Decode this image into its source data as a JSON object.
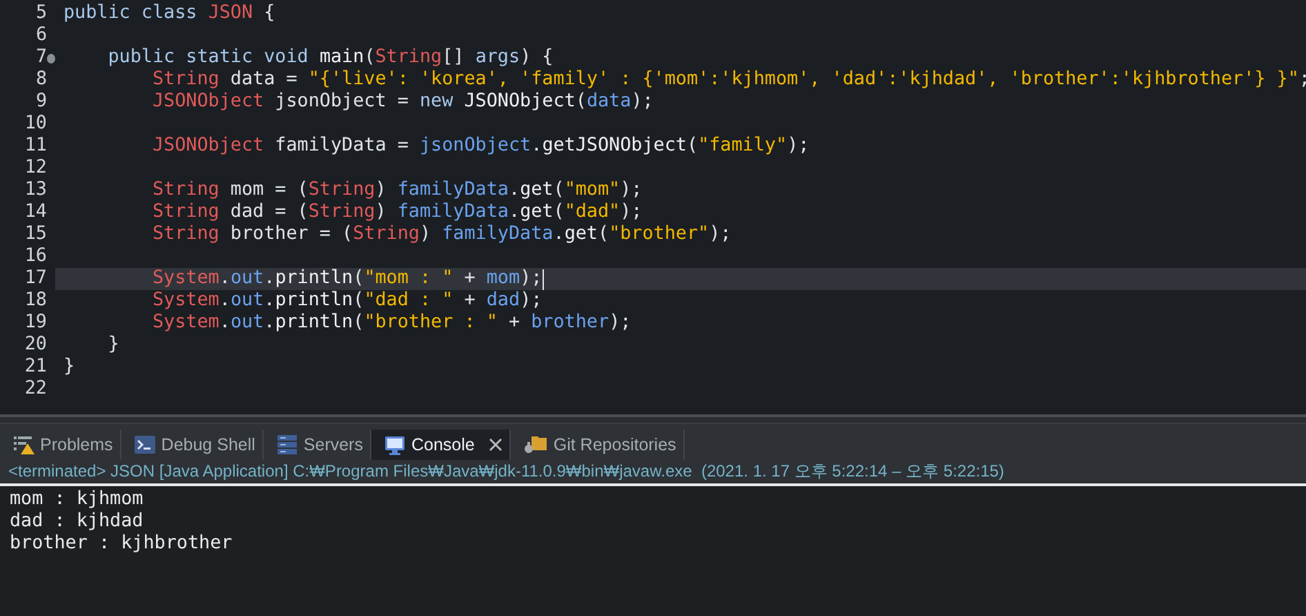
{
  "editor": {
    "lines": [
      {
        "number": "5",
        "tokens": [
          {
            "kind": "kw",
            "text": "public class "
          },
          {
            "kind": "type",
            "text": "JSON"
          },
          {
            "kind": "plain",
            "text": " {"
          }
        ]
      },
      {
        "number": "6"
      },
      {
        "number": "7",
        "fold": true,
        "tokens": [
          {
            "kind": "kw",
            "text": "    public static void "
          },
          {
            "kind": "method",
            "text": "main"
          },
          {
            "kind": "plain",
            "text": "("
          },
          {
            "kind": "type",
            "text": "String"
          },
          {
            "kind": "plain",
            "text": "[] "
          },
          {
            "kind": "kw",
            "text": "args"
          },
          {
            "kind": "plain",
            "text": ") {"
          }
        ]
      },
      {
        "number": "8",
        "tokens": [
          {
            "kind": "type",
            "text": "        String"
          },
          {
            "kind": "plain",
            "text": " data = "
          },
          {
            "kind": "str",
            "text": "\"{'live': 'korea', 'family' : {'mom':'kjhmom', 'dad':'kjhdad', 'brother':'kjhbrother'} }\""
          },
          {
            "kind": "plain",
            "text": ";"
          }
        ]
      },
      {
        "number": "9",
        "tokens": [
          {
            "kind": "type",
            "text": "        JSONObject"
          },
          {
            "kind": "plain",
            "text": " jsonObject = "
          },
          {
            "kind": "kw",
            "text": "new"
          },
          {
            "kind": "method",
            "text": " JSONObject"
          },
          {
            "kind": "plain",
            "text": "("
          },
          {
            "kind": "field",
            "text": "data"
          },
          {
            "kind": "plain",
            "text": ");"
          }
        ]
      },
      {
        "number": "10"
      },
      {
        "number": "11",
        "tokens": [
          {
            "kind": "type",
            "text": "        JSONObject"
          },
          {
            "kind": "plain",
            "text": " familyData = "
          },
          {
            "kind": "field",
            "text": "jsonObject"
          },
          {
            "kind": "plain",
            "text": "."
          },
          {
            "kind": "method",
            "text": "getJSONObject"
          },
          {
            "kind": "plain",
            "text": "("
          },
          {
            "kind": "str",
            "text": "\"family\""
          },
          {
            "kind": "plain",
            "text": ");"
          }
        ]
      },
      {
        "number": "12"
      },
      {
        "number": "13",
        "tokens": [
          {
            "kind": "type",
            "text": "        String"
          },
          {
            "kind": "plain",
            "text": " mom = ("
          },
          {
            "kind": "type",
            "text": "String"
          },
          {
            "kind": "plain",
            "text": ") "
          },
          {
            "kind": "field",
            "text": "familyData"
          },
          {
            "kind": "plain",
            "text": "."
          },
          {
            "kind": "method",
            "text": "get"
          },
          {
            "kind": "plain",
            "text": "("
          },
          {
            "kind": "str",
            "text": "\"mom\""
          },
          {
            "kind": "plain",
            "text": ");"
          }
        ]
      },
      {
        "number": "14",
        "tokens": [
          {
            "kind": "type",
            "text": "        String"
          },
          {
            "kind": "plain",
            "text": " dad = ("
          },
          {
            "kind": "type",
            "text": "String"
          },
          {
            "kind": "plain",
            "text": ") "
          },
          {
            "kind": "field",
            "text": "familyData"
          },
          {
            "kind": "plain",
            "text": "."
          },
          {
            "kind": "method",
            "text": "get"
          },
          {
            "kind": "plain",
            "text": "("
          },
          {
            "kind": "str",
            "text": "\"dad\""
          },
          {
            "kind": "plain",
            "text": ");"
          }
        ]
      },
      {
        "number": "15",
        "tokens": [
          {
            "kind": "type",
            "text": "        String"
          },
          {
            "kind": "plain",
            "text": " brother = ("
          },
          {
            "kind": "type",
            "text": "String"
          },
          {
            "kind": "plain",
            "text": ") "
          },
          {
            "kind": "field",
            "text": "familyData"
          },
          {
            "kind": "plain",
            "text": "."
          },
          {
            "kind": "method",
            "text": "get"
          },
          {
            "kind": "plain",
            "text": "("
          },
          {
            "kind": "str",
            "text": "\"brother\""
          },
          {
            "kind": "plain",
            "text": ");"
          }
        ]
      },
      {
        "number": "16"
      },
      {
        "number": "17",
        "current": true,
        "tokens": [
          {
            "kind": "type",
            "text": "        System"
          },
          {
            "kind": "plain",
            "text": "."
          },
          {
            "kind": "field",
            "text": "out"
          },
          {
            "kind": "plain",
            "text": "."
          },
          {
            "kind": "method",
            "text": "println"
          },
          {
            "kind": "plain",
            "text": "("
          },
          {
            "kind": "str",
            "text": "\"mom : \""
          },
          {
            "kind": "plain",
            "text": " + "
          },
          {
            "kind": "field",
            "text": "mom"
          },
          {
            "kind": "plain",
            "text": ");"
          }
        ]
      },
      {
        "number": "18",
        "tokens": [
          {
            "kind": "type",
            "text": "        System"
          },
          {
            "kind": "plain",
            "text": "."
          },
          {
            "kind": "field",
            "text": "out"
          },
          {
            "kind": "plain",
            "text": "."
          },
          {
            "kind": "method",
            "text": "println"
          },
          {
            "kind": "plain",
            "text": "("
          },
          {
            "kind": "str",
            "text": "\"dad : \""
          },
          {
            "kind": "plain",
            "text": " + "
          },
          {
            "kind": "field",
            "text": "dad"
          },
          {
            "kind": "plain",
            "text": ");"
          }
        ]
      },
      {
        "number": "19",
        "tokens": [
          {
            "kind": "type",
            "text": "        System"
          },
          {
            "kind": "plain",
            "text": "."
          },
          {
            "kind": "field",
            "text": "out"
          },
          {
            "kind": "plain",
            "text": "."
          },
          {
            "kind": "method",
            "text": "println"
          },
          {
            "kind": "plain",
            "text": "("
          },
          {
            "kind": "str",
            "text": "\"brother : \""
          },
          {
            "kind": "plain",
            "text": " + "
          },
          {
            "kind": "field",
            "text": "brother"
          },
          {
            "kind": "plain",
            "text": ");"
          }
        ]
      },
      {
        "number": "20",
        "tokens": [
          {
            "kind": "plain",
            "text": "    }"
          }
        ]
      },
      {
        "number": "21",
        "tokens": [
          {
            "kind": "plain",
            "text": "}"
          }
        ]
      },
      {
        "number": "22"
      }
    ]
  },
  "panel": {
    "tabs": [
      {
        "label": "Problems",
        "kind": "problems",
        "selected": false
      },
      {
        "label": "Debug Shell",
        "kind": "shell",
        "selected": false
      },
      {
        "label": "Servers",
        "kind": "servers",
        "selected": false
      },
      {
        "label": "Console",
        "kind": "console",
        "selected": true,
        "closable": true
      },
      {
        "label": "Git Repositories",
        "kind": "git",
        "selected": false
      }
    ],
    "info": "<terminated> JSON [Java Application] C:₩Program Files₩Java₩jdk-11.0.9₩bin₩javaw.exe  (2021. 1. 17 오후 5:22:14 – 오후 5:22:15)",
    "output": [
      "mom : kjhmom",
      "dad : kjhdad",
      "brother : kjhbrother"
    ]
  }
}
